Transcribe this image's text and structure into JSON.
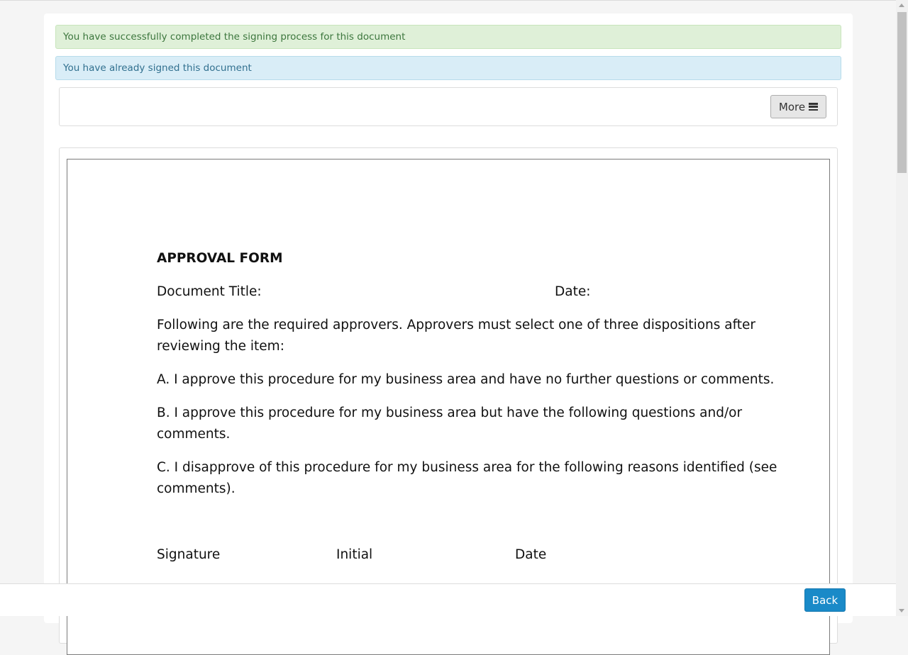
{
  "alerts": {
    "success": "You have successfully completed the signing process for this document",
    "info": "You have already signed this document"
  },
  "toolbar": {
    "more_label": "More",
    "more_icon": "bars-icon"
  },
  "document": {
    "title": "APPROVAL FORM",
    "doc_title_label": "Document Title:",
    "date_label": "Date:",
    "intro": "Following are the required approvers. Approvers must select one of three dispositions after reviewing the item:",
    "option_a": "A. I approve this procedure for my business area and have no further questions or comments.",
    "option_b": "B. I approve this procedure for my business area but have the following questions and/or comments.",
    "option_c": "C. I disapprove of this procedure for my business area for the following reasons identified (see comments).",
    "signature_label": "Signature",
    "initial_label": "Initial",
    "sig_date_label": "Date"
  },
  "footer": {
    "back_label": "Back"
  },
  "colors": {
    "success_bg": "#dff0d8",
    "info_bg": "#d9edf7",
    "primary": "#1a8ac8"
  }
}
